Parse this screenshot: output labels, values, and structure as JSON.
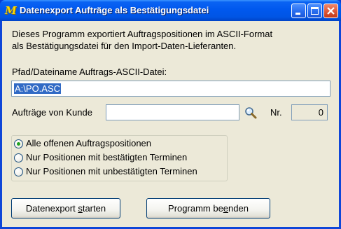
{
  "window": {
    "title": "Datenexport Aufträge als Bestätigungsdatei",
    "app_icon_glyph": "M"
  },
  "intro": {
    "line1": "Dieses Programm exportiert Auftragspositionen im ASCII-Format",
    "line2": "als Bestätigungsdatei für den Import-Daten-Lieferanten."
  },
  "path": {
    "label": "Pfad/Dateiname Auftrags-ASCII-Datei:",
    "value": "A:\\PO.ASC"
  },
  "customer": {
    "label": "Aufträge von Kunde",
    "value": "",
    "nr_label": "Nr.",
    "nr_value": "0"
  },
  "options": [
    {
      "label": "Alle offenen Auftragspositionen",
      "selected": true
    },
    {
      "label": "Nur Positionen mit bestätigten Terminen",
      "selected": false
    },
    {
      "label": "Nur Positionen mit unbestätigten Terminen",
      "selected": false
    }
  ],
  "buttons": {
    "start_pre": "Datenexport ",
    "start_mnemonic": "s",
    "start_post": "tarten",
    "end_pre": "Programm be",
    "end_mnemonic": "e",
    "end_post": "nden"
  },
  "colors": {
    "titlebar": "#0058ee",
    "selection": "#316ac5",
    "dialog_bg": "#ece9d8",
    "radio_dot": "#21a121"
  }
}
